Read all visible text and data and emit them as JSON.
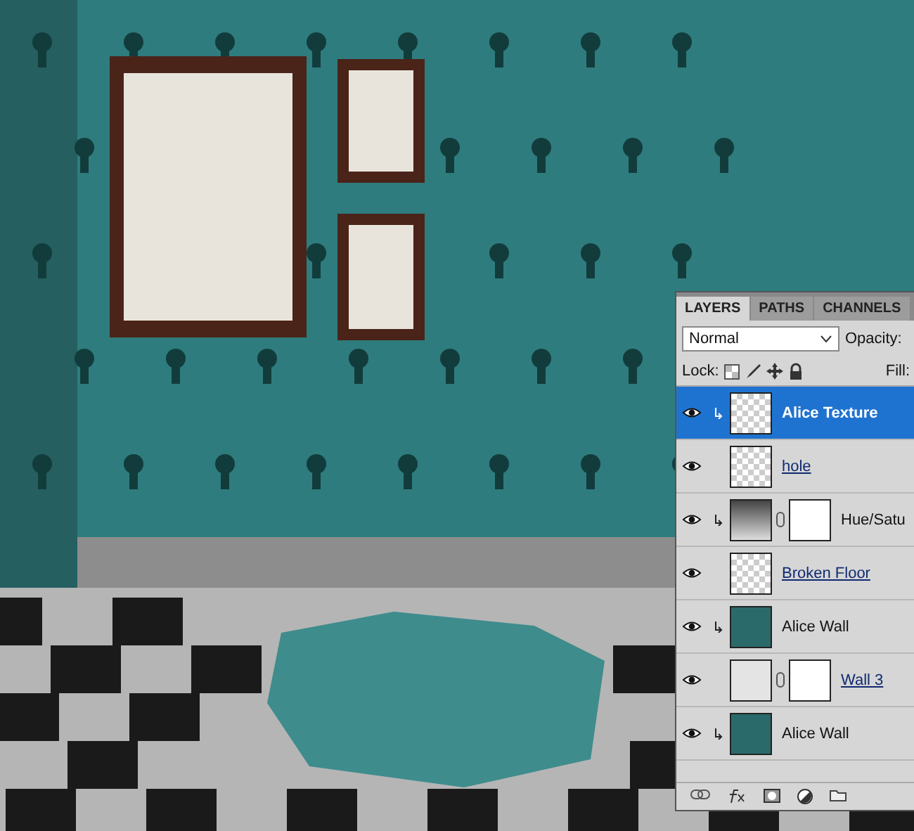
{
  "tabs": [
    {
      "label": "LAYERS",
      "selected": true
    },
    {
      "label": "PATHS",
      "selected": false
    },
    {
      "label": "CHANNELS",
      "selected": false
    }
  ],
  "blend_mode": {
    "value": "Normal"
  },
  "opacity_label": "Opacity:",
  "lock_label": "Lock:",
  "fill_label": "Fill:",
  "layers": [
    {
      "name": "Alice Texture",
      "kind": "pixel",
      "selected": true,
      "clipped": true,
      "underlined": false,
      "mask": false
    },
    {
      "name": "hole",
      "kind": "pixel",
      "selected": false,
      "clipped": false,
      "underlined": true,
      "mask": false
    },
    {
      "name": "Hue/Satu",
      "kind": "adjustment",
      "selected": false,
      "clipped": true,
      "underlined": false,
      "mask": true
    },
    {
      "name": "Broken Floor",
      "kind": "pixel",
      "selected": false,
      "clipped": false,
      "underlined": true,
      "mask": false
    },
    {
      "name": "Alice Wall",
      "kind": "smart",
      "selected": false,
      "clipped": true,
      "underlined": false,
      "mask": false
    },
    {
      "name": "Wall 3",
      "kind": "fill",
      "selected": false,
      "clipped": false,
      "underlined": true,
      "mask": true
    },
    {
      "name": "Alice Wall",
      "kind": "smart",
      "selected": false,
      "clipped": true,
      "underlined": false,
      "mask": false
    }
  ]
}
